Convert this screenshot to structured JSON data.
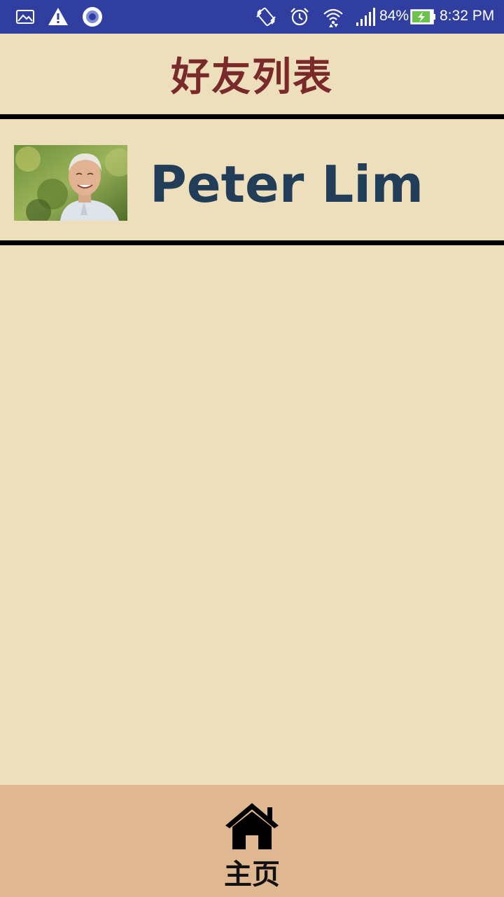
{
  "status_bar": {
    "battery": "84%",
    "time": "8:32 PM",
    "background": "#303f9f",
    "icons": [
      "image-icon",
      "warning-icon",
      "record-icon",
      "vibrate-icon",
      "alarm-icon",
      "wifi-icon",
      "signal-icon",
      "battery-charging-icon"
    ]
  },
  "header": {
    "title": "好友列表"
  },
  "friends": [
    {
      "name": "Peter Lim"
    }
  ],
  "bottom_nav": {
    "home_label": "主页"
  },
  "colors": {
    "background": "#eedfbc",
    "title": "#7a2a2a",
    "name": "#213d57",
    "nav_background": "#dfb891"
  }
}
